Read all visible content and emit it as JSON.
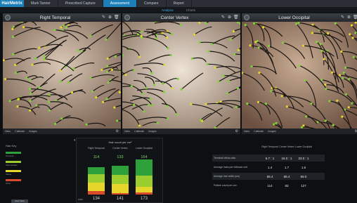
{
  "app": {
    "logo": "HairMetrix",
    "nav": [
      "Mark Tanner",
      "Prescribed Capture",
      "Assessment",
      "Compare",
      "Report"
    ],
    "nav_active": 2,
    "subtabs": [
      "Analysis",
      "Charts"
    ],
    "subtab_active": 0,
    "brand_color": "#1c7fb8"
  },
  "panels": [
    {
      "title": "Right Temporal",
      "foot": [
        "Hairs",
        "Calibrate",
        "Images"
      ]
    },
    {
      "title": "Center Vertex",
      "foot": [
        "Hairs",
        "Calibrate",
        "Images"
      ]
    },
    {
      "title": "Lower Occipital",
      "foot": [
        "Hairs",
        "Calibrate",
        "Images"
      ]
    }
  ],
  "legend": {
    "title": "Hair Key",
    "items": [
      {
        "label": "Terminal",
        "color": "#2ea13a"
      },
      {
        "label": "Intermediate",
        "color": "#9ccd2e"
      },
      {
        "label": "Vellus",
        "color": "#e6d52a"
      },
      {
        "label": "Other",
        "color": "#d94a2c"
      }
    ],
    "button": "Auto Tone"
  },
  "chart": {
    "title": "Hair count per cm²",
    "bottom_label": "total",
    "columns": [
      {
        "name": "Right Temporal",
        "top_total": "114",
        "bottom_total": "134",
        "red_count": "17"
      },
      {
        "name": "Center Vertex",
        "top_total": "133",
        "bottom_total": "141",
        "red_count": "8"
      },
      {
        "name": "Lower Occipital",
        "top_total": "164",
        "bottom_total": "173",
        "red_count": "9"
      }
    ]
  },
  "chart_data": {
    "type": "bar",
    "categories": [
      "Right Temporal",
      "Center Vertex",
      "Lower Occipital"
    ],
    "series": [
      {
        "name": "Other",
        "values": [
          17,
          8,
          9
        ]
      },
      {
        "name": "Vellus",
        "values": [
          43,
          45,
          28
        ]
      },
      {
        "name": "Intermediate",
        "values": [
          40,
          45,
          56
        ]
      },
      {
        "name": "Terminal",
        "values": [
          34,
          43,
          80
        ]
      }
    ],
    "title": "Hair count per cm²"
  },
  "table": {
    "headers": [
      "Right Temporal",
      "Center Vertex",
      "Lower Occipital"
    ],
    "rows": [
      {
        "label": "Terminal:Vellus ratio",
        "values": [
          "6.7 : 1",
          "16.0 : 1",
          "23.0 : 1"
        ]
      },
      {
        "label": "Average hairs per follicular unit",
        "values": [
          "1.4",
          "1.7",
          "1.6"
        ]
      },
      {
        "label": "Average hair width (um)",
        "values": [
          "58.4",
          "68.4",
          "69.0"
        ]
      },
      {
        "label": "Follicle count per cm²",
        "values": [
          "114",
          "83",
          "127"
        ]
      }
    ]
  }
}
